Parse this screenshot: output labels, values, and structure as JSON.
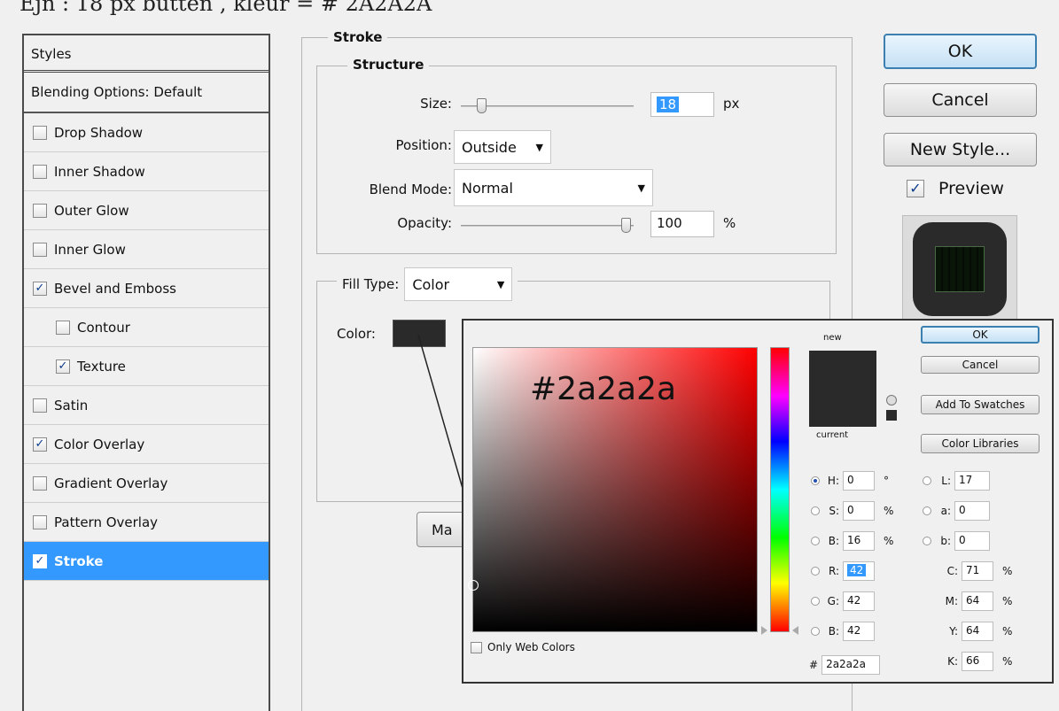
{
  "caption": "Ejn : 18 px butten , kleur = # 2A2A2A",
  "styles_panel": {
    "header": "Styles",
    "blending": "Blending Options: Default",
    "items": [
      {
        "label": "Drop Shadow",
        "checked": false,
        "indent": false,
        "selected": false
      },
      {
        "label": "Inner Shadow",
        "checked": false,
        "indent": false,
        "selected": false
      },
      {
        "label": "Outer Glow",
        "checked": false,
        "indent": false,
        "selected": false
      },
      {
        "label": "Inner Glow",
        "checked": false,
        "indent": false,
        "selected": false
      },
      {
        "label": "Bevel and Emboss",
        "checked": true,
        "indent": false,
        "selected": false
      },
      {
        "label": "Contour",
        "checked": false,
        "indent": true,
        "selected": false
      },
      {
        "label": "Texture",
        "checked": true,
        "indent": true,
        "selected": false
      },
      {
        "label": "Satin",
        "checked": false,
        "indent": false,
        "selected": false
      },
      {
        "label": "Color Overlay",
        "checked": true,
        "indent": false,
        "selected": false
      },
      {
        "label": "Gradient Overlay",
        "checked": false,
        "indent": false,
        "selected": false
      },
      {
        "label": "Pattern Overlay",
        "checked": false,
        "indent": false,
        "selected": false
      },
      {
        "label": "Stroke",
        "checked": true,
        "indent": false,
        "selected": true
      }
    ]
  },
  "stroke": {
    "title": "Stroke",
    "structure_title": "Structure",
    "size_label": "Size:",
    "size_value": "18",
    "size_unit": "px",
    "size_slider_fraction": 0.12,
    "position_label": "Position:",
    "position_value": "Outside",
    "blend_label": "Blend Mode:",
    "blend_value": "Normal",
    "opacity_label": "Opacity:",
    "opacity_value": "100",
    "opacity_unit": "%",
    "opacity_slider_fraction": 1.0,
    "fill_type_label": "Fill Type:",
    "fill_type_value": "Color",
    "color_label": "Color:",
    "color_swatch": "#2a2a2a",
    "make_default_partial": "Ma"
  },
  "dialog_buttons": {
    "ok": "OK",
    "cancel": "Cancel",
    "new_style": "New Style...",
    "preview_label": "Preview",
    "preview_checked": true
  },
  "picker": {
    "overlay_text": "#2a2a2a",
    "new_label": "new",
    "current_label": "current",
    "new_color": "#2a2a2a",
    "current_color": "#2a2a2a",
    "ok": "OK",
    "cancel": "Cancel",
    "add_swatches": "Add To Swatches",
    "color_libraries": "Color Libraries",
    "only_web": "Only Web Colors",
    "hsb": [
      {
        "label": "H:",
        "value": "0",
        "unit": "°",
        "on": true
      },
      {
        "label": "S:",
        "value": "0",
        "unit": "%",
        "on": false
      },
      {
        "label": "B:",
        "value": "16",
        "unit": "%",
        "on": false
      }
    ],
    "rgb": [
      {
        "label": "R:",
        "value": "42"
      },
      {
        "label": "G:",
        "value": "42"
      },
      {
        "label": "B:",
        "value": "42"
      }
    ],
    "lab": [
      {
        "label": "L:",
        "value": "17"
      },
      {
        "label": "a:",
        "value": "0"
      },
      {
        "label": "b:",
        "value": "0"
      }
    ],
    "cmyk": [
      {
        "label": "C:",
        "value": "71",
        "unit": "%"
      },
      {
        "label": "M:",
        "value": "64",
        "unit": "%"
      },
      {
        "label": "Y:",
        "value": "64",
        "unit": "%"
      },
      {
        "label": "K:",
        "value": "66",
        "unit": "%"
      }
    ],
    "hex_label": "#",
    "hex_value": "2a2a2a"
  },
  "colors": {
    "selection": "#3399ff",
    "swatch": "#2a2a2a"
  }
}
